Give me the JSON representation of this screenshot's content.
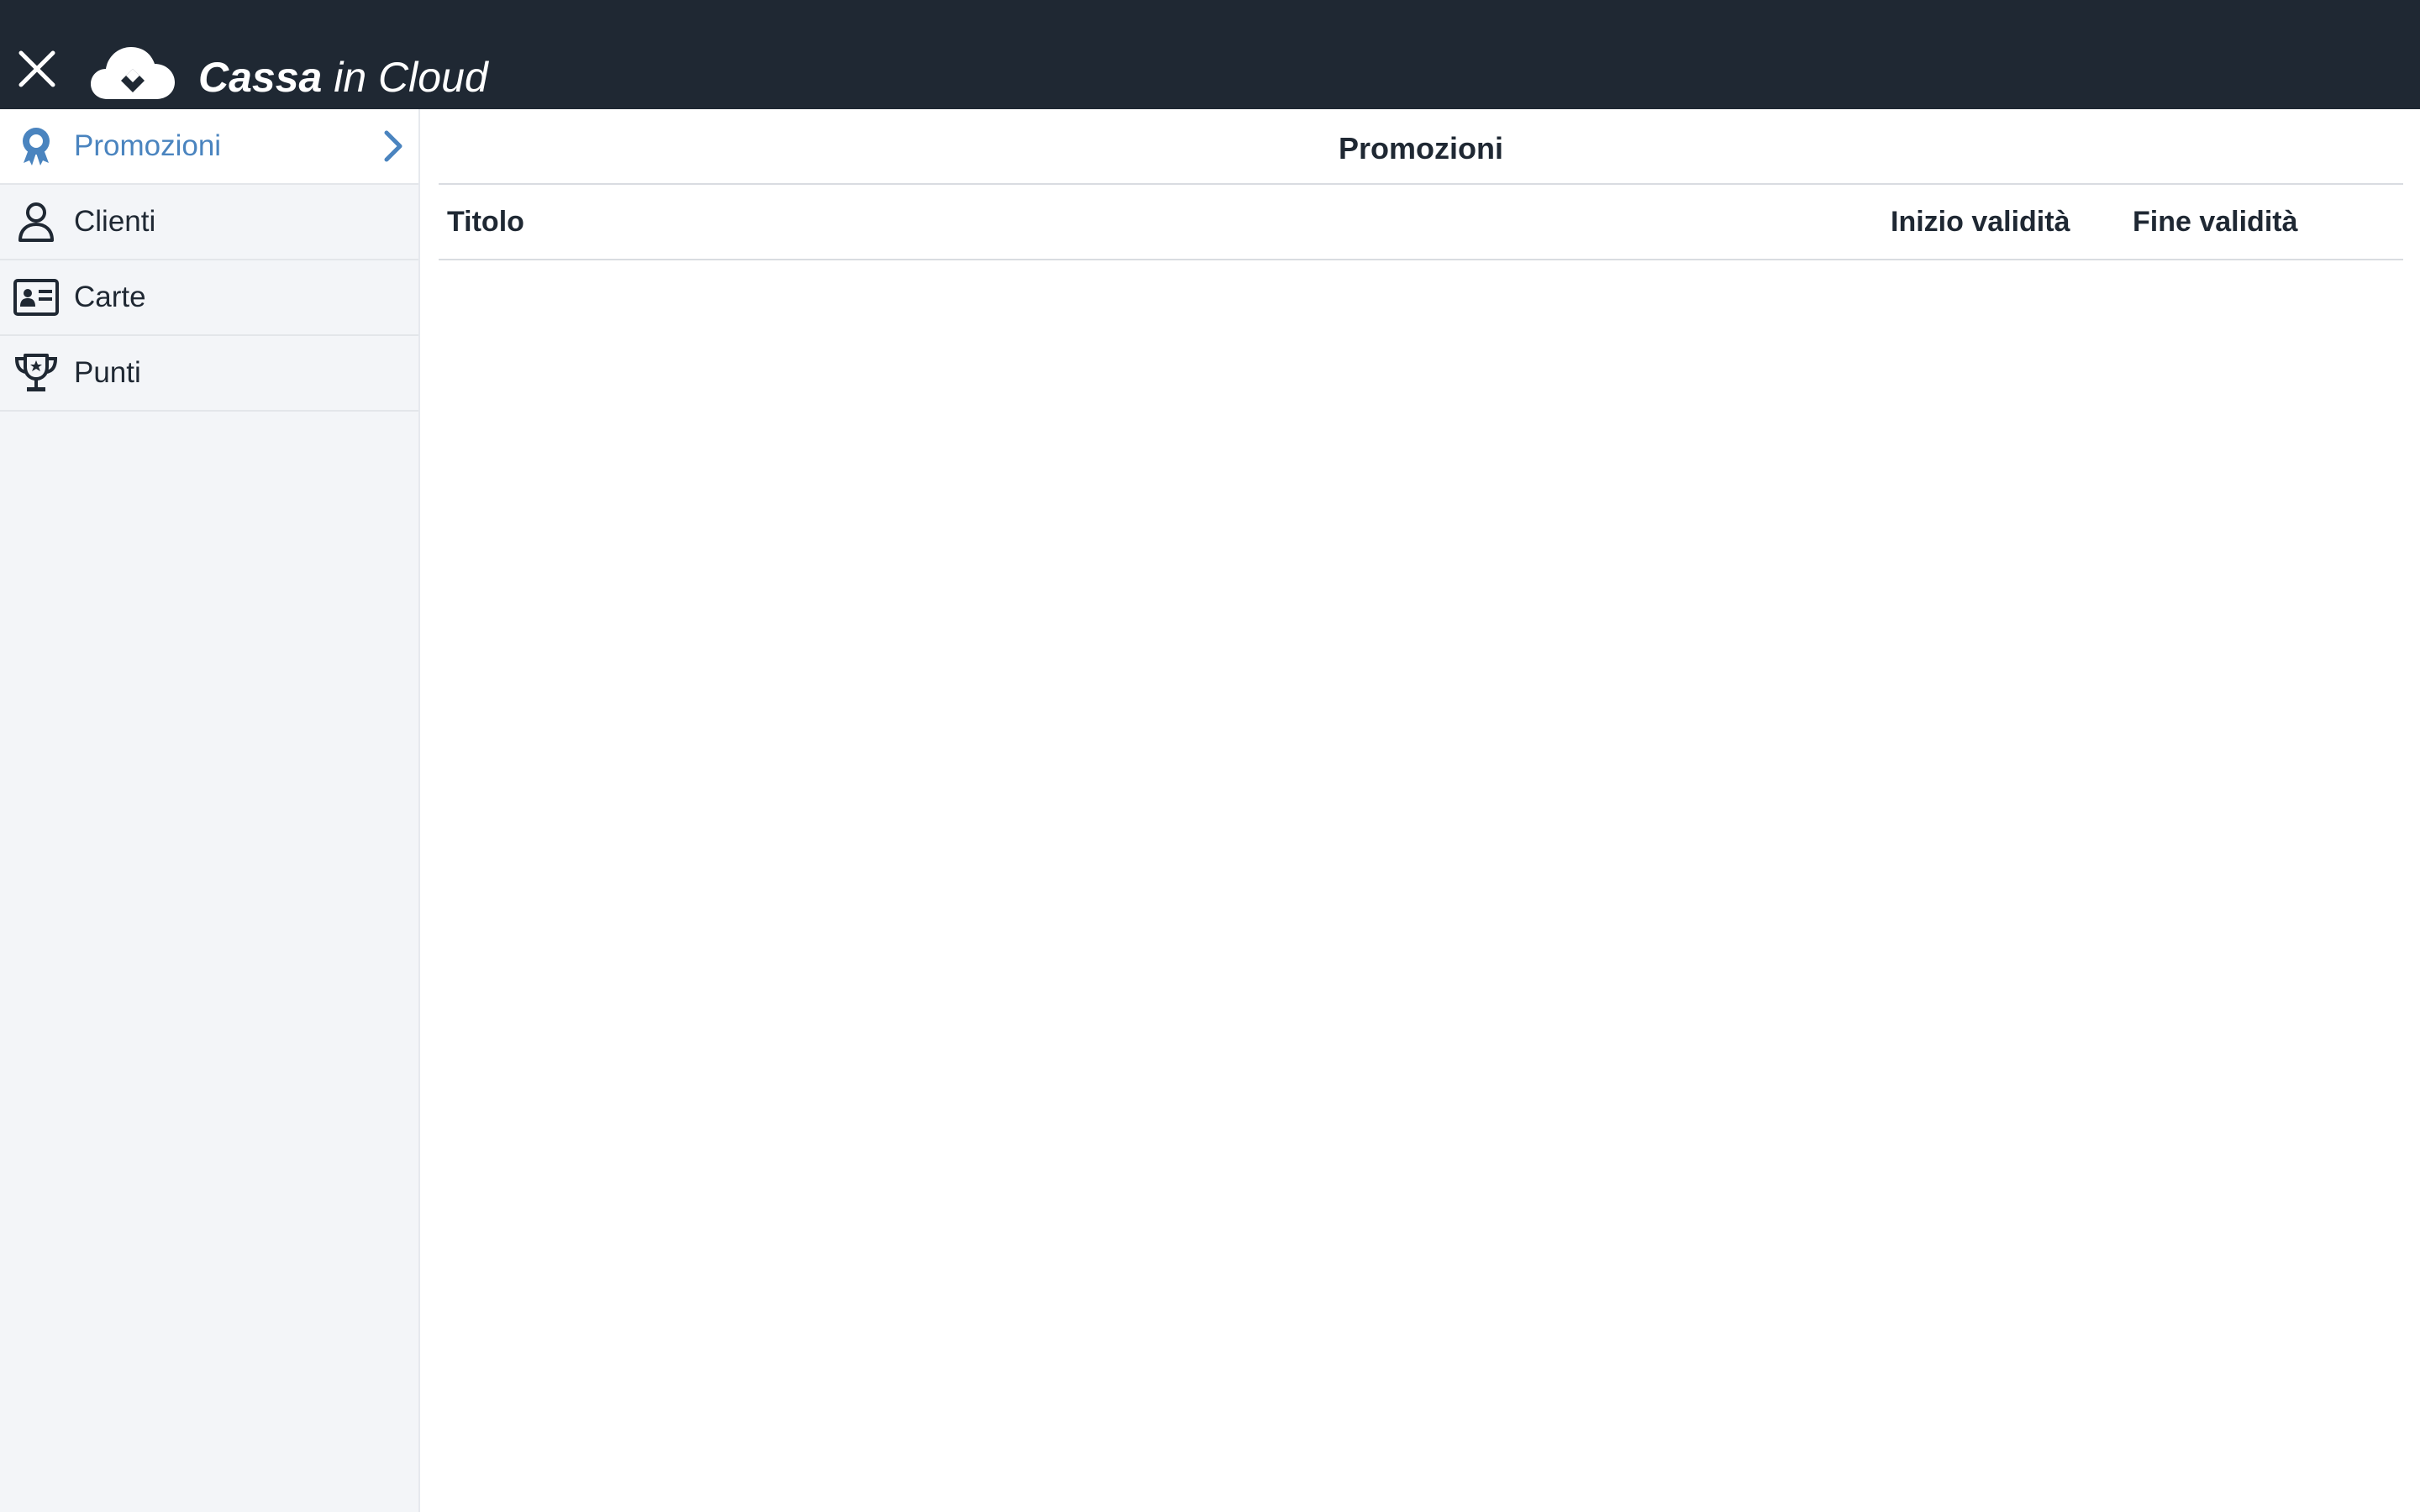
{
  "header": {
    "brand_bold": "Cassa",
    "brand_light": " in Cloud",
    "close_icon": "close-icon",
    "logo_icon": "cloud-logo-icon",
    "background": "#1f2833"
  },
  "sidebar": {
    "items": [
      {
        "label": "Promozioni",
        "icon": "award-icon",
        "active": true
      },
      {
        "label": "Clienti",
        "icon": "user-icon",
        "active": false
      },
      {
        "label": "Carte",
        "icon": "id-card-icon",
        "active": false
      },
      {
        "label": "Punti",
        "icon": "trophy-icon",
        "active": false
      }
    ],
    "active_color": "#4a84bf"
  },
  "main": {
    "title": "Promozioni",
    "table": {
      "columns": [
        "Titolo",
        "Inizio validità",
        "Fine validità"
      ],
      "rows": []
    }
  }
}
